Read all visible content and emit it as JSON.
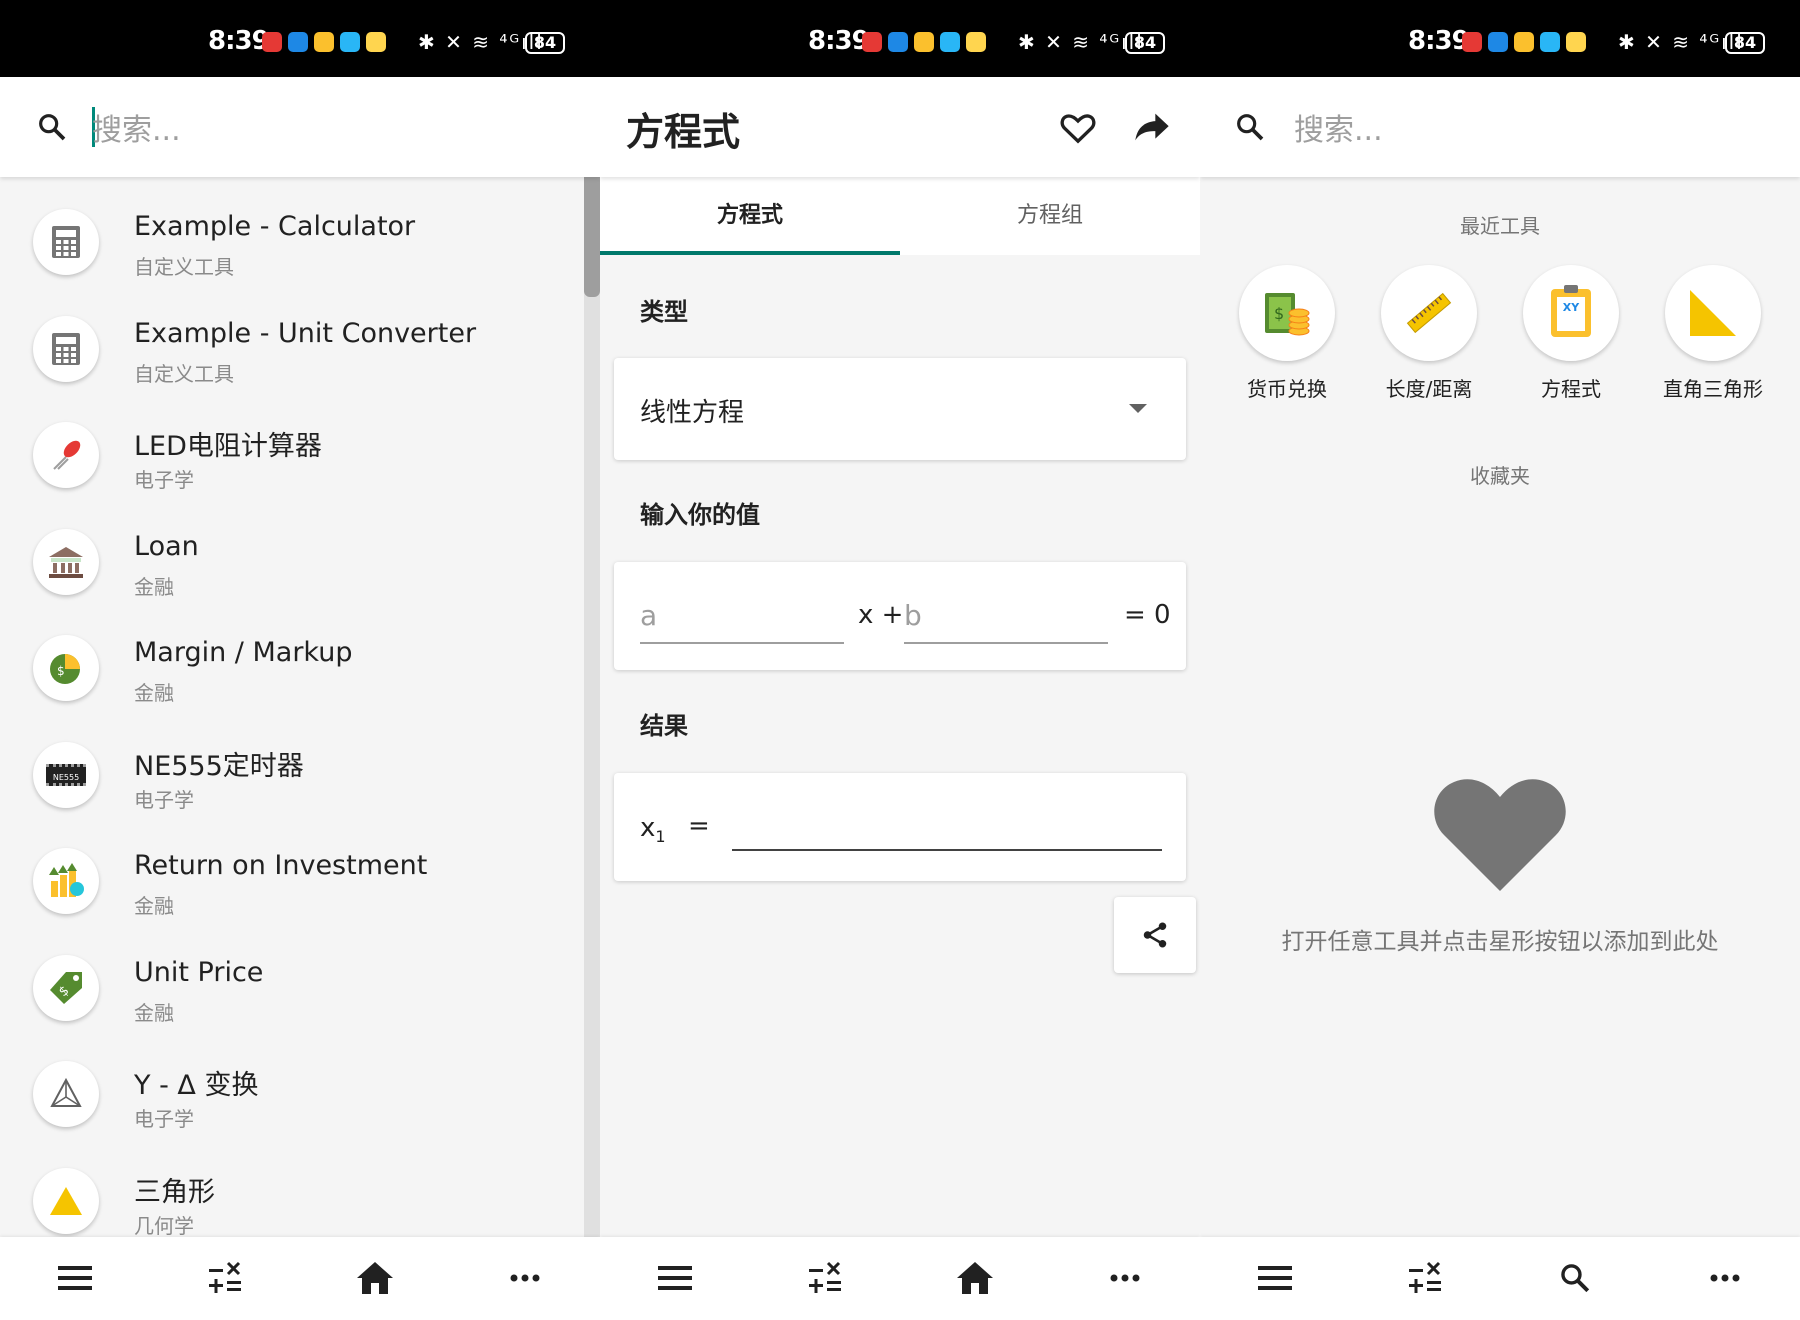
{
  "status_bar": {
    "time": "8:39",
    "battery": "84",
    "system_icons": "✱ ✕ ≋ ⁴ᴳıll"
  },
  "panel_left": {
    "search_placeholder": "搜索...",
    "items": [
      {
        "title": "Example - Calculator",
        "subtitle": "自定义工具",
        "icon": "calculator-icon"
      },
      {
        "title": "Example - Unit Converter",
        "subtitle": "自定义工具",
        "icon": "calculator-icon"
      },
      {
        "title": "LED电阻计算器",
        "subtitle": "电子学",
        "icon": "led-icon"
      },
      {
        "title": "Loan",
        "subtitle": "金融",
        "icon": "bank-icon"
      },
      {
        "title": "Margin / Markup",
        "subtitle": "金融",
        "icon": "pie-coin-icon"
      },
      {
        "title": "NE555定时器",
        "subtitle": "电子学",
        "icon": "chip-icon",
        "icon_text": "NE555"
      },
      {
        "title": "Return on Investment",
        "subtitle": "金融",
        "icon": "growth-icon"
      },
      {
        "title": "Unit Price",
        "subtitle": "金融",
        "icon": "price-tag-icon"
      },
      {
        "title": "Y - Δ 变换",
        "subtitle": "电子学",
        "icon": "delta-icon"
      },
      {
        "title": "三角形",
        "subtitle": "几何学",
        "icon": "triangle-icon"
      }
    ]
  },
  "panel_middle": {
    "title": "方程式",
    "tabs": [
      {
        "label": "方程式",
        "active": true
      },
      {
        "label": "方程组",
        "active": false
      }
    ],
    "type_header": "类型",
    "type_value": "线性方程",
    "input_header": "输入你的值",
    "input_a_placeholder": "a",
    "input_b_placeholder": "b",
    "x_plus": "x +",
    "equals_zero": "= 0",
    "result_header": "结果",
    "result_label": "x",
    "result_sub": "1",
    "result_eq": "=",
    "result_value": ""
  },
  "panel_right": {
    "search_placeholder": "搜索...",
    "recent_header": "最近工具",
    "recent_tools": [
      {
        "label": "货币兑换",
        "icon": "currency-icon"
      },
      {
        "label": "长度/距离",
        "icon": "ruler-icon"
      },
      {
        "label": "方程式",
        "icon": "clipboard-xy-icon",
        "icon_text": "XY"
      },
      {
        "label": "直角三角形",
        "icon": "right-triangle-icon"
      }
    ],
    "favorites_header": "收藏夹",
    "empty_message": "打开任意工具并点击星形按钮以添加到此处"
  },
  "colors": {
    "accent": "#00796b",
    "background": "#f5f5f5",
    "icon_gray": "#757575",
    "yellow": "#f5c400"
  }
}
